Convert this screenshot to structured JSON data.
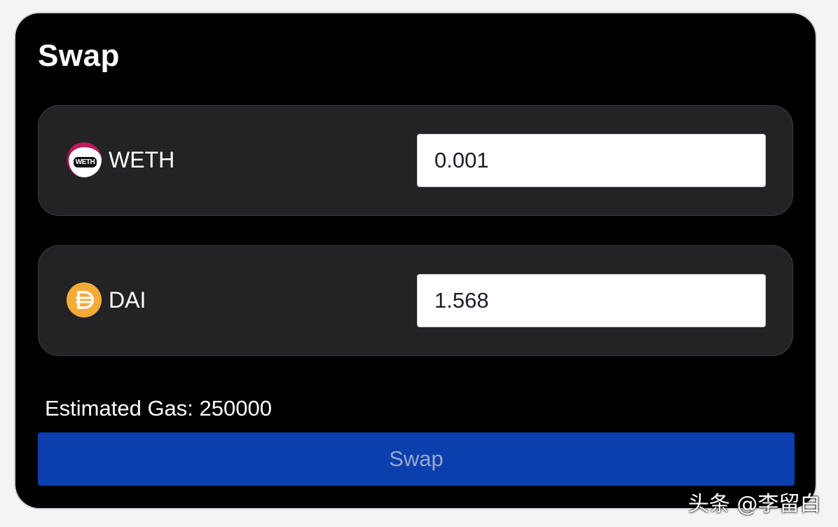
{
  "app": {
    "title": "Swap"
  },
  "tokens": [
    {
      "symbol": "WETH",
      "icon": "weth-token-icon",
      "icon_text": "WETH",
      "amount": "0.001"
    },
    {
      "symbol": "DAI",
      "icon": "dai-token-icon",
      "amount": "1.568"
    }
  ],
  "gas": {
    "label": "Estimated Gas: 250000"
  },
  "actions": {
    "swap_label": "Swap"
  },
  "watermark": {
    "text": "头条 @李留白"
  },
  "colors": {
    "background": "#000000",
    "token_box": "#232325",
    "swap_button": "#0b3fae",
    "swap_button_text": "#98a8cc",
    "dai_brand": "#f5ac37",
    "weth_brand": "#c2185b"
  }
}
